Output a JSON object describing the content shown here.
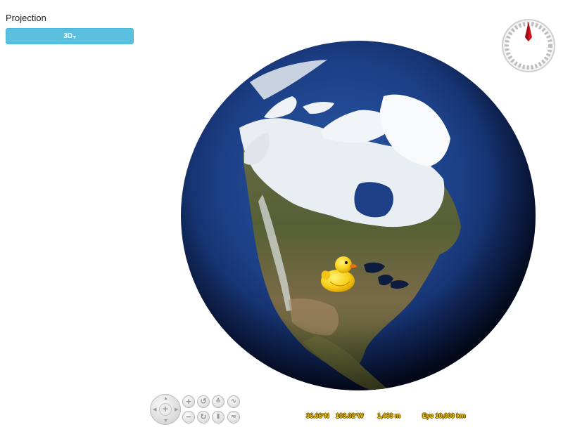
{
  "projection": {
    "label": "Projection",
    "selected": "3D",
    "caret": "▾"
  },
  "compass": {
    "icon": "compass-icon",
    "needle_color": "#d0101a"
  },
  "globe": {
    "icon": "earth-globe",
    "placemark_icon": "rubber-duck-icon"
  },
  "controls": {
    "pan_icon": "pan-arrows-icon",
    "zoom_in_icon": "zoom-in-icon",
    "zoom_out_icon": "zoom-out-icon",
    "rotate_ccw_icon": "rotate-ccw-icon",
    "rotate_cw_icon": "rotate-cw-icon",
    "tilt_up_icon": "tilt-up-icon",
    "tilt_down_icon": "tilt-down-icon",
    "exaggeration_up_icon": "exaggeration-up-icon",
    "exaggeration_down_icon": "exaggeration-down-icon",
    "glyphs": {
      "plus": "+",
      "minus": "−",
      "rotate_ccw": "↺",
      "rotate_cw": "↻",
      "tilt_up": "≙",
      "tilt_down": "⦀",
      "exag_up": "∿",
      "exag_down": "≈"
    }
  },
  "coordinates": {
    "lat": "36.66°N",
    "lon": "103.02°W",
    "elevation": "1,463 m",
    "eye": "Eye  10,000 km"
  },
  "colors": {
    "button_bg": "#5bc0de",
    "coords_text": "#f1c40f"
  }
}
